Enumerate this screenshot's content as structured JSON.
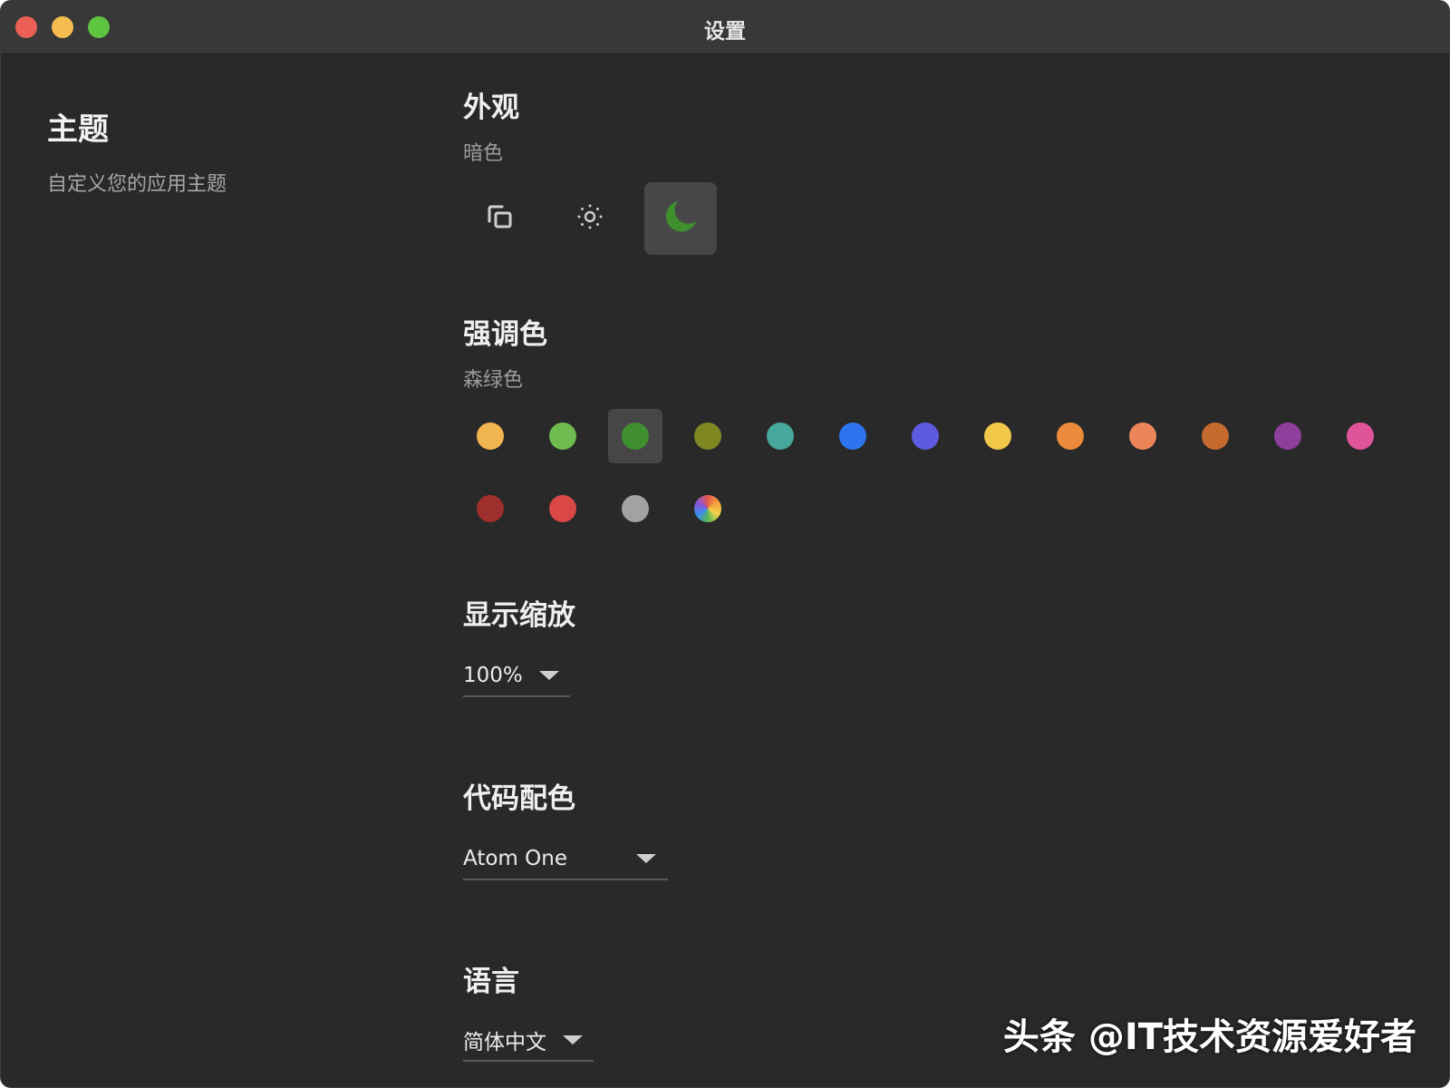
{
  "window": {
    "title": "设置"
  },
  "sidebar": {
    "title": "主题",
    "description": "自定义您的应用主题"
  },
  "appearance": {
    "title": "外观",
    "current": "暗色",
    "modes": [
      {
        "icon": "system-mode-icon"
      },
      {
        "icon": "sun-icon"
      },
      {
        "icon": "moon-icon",
        "selected": true,
        "color": "#3f8f2f"
      }
    ]
  },
  "accent": {
    "title": "强调色",
    "current": "森绿色",
    "colors": [
      "#f1b54f",
      "#6ebb4f",
      "#3f8f2f",
      "#7f8723",
      "#47a89b",
      "#2e73f0",
      "#5c5bdf",
      "#f2c84a",
      "#ea8a3a",
      "#ec8659",
      "#c46a2f",
      "#8e3f9c",
      "#e0559a",
      "#9e2f2c",
      "#d94746",
      "#a2a2a2",
      "rainbow"
    ],
    "selected_index": 2
  },
  "zoom": {
    "title": "显示缩放",
    "value": "100%"
  },
  "code_theme": {
    "title": "代码配色",
    "value": "Atom One"
  },
  "language": {
    "title": "语言",
    "value": "简体中文"
  },
  "watermark": "头条 @IT技术资源爱好者"
}
